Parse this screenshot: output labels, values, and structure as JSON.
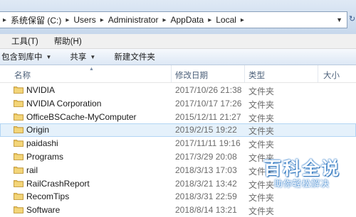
{
  "address_bar": {
    "crumbs": [
      "系统保留 (C:)",
      "Users",
      "Administrator",
      "AppData",
      "Local"
    ],
    "separator": "▸"
  },
  "menu": {
    "items": [
      "工具(T)",
      "帮助(H)"
    ]
  },
  "toolbar": {
    "include_library": "包含到库中",
    "share": "共享",
    "new_folder": "新建文件夹"
  },
  "columns": {
    "name": "名称",
    "date": "修改日期",
    "type": "类型",
    "size": "大小"
  },
  "files": [
    {
      "name": "NVIDIA",
      "date": "2017/10/26 21:38",
      "type": "文件夹"
    },
    {
      "name": "NVIDIA Corporation",
      "date": "2017/10/17 17:26",
      "type": "文件夹"
    },
    {
      "name": "OfficeBSCache-MyComputer",
      "date": "2015/12/11 21:27",
      "type": "文件夹"
    },
    {
      "name": "Origin",
      "date": "2019/2/15 19:22",
      "type": "文件夹",
      "selected": true
    },
    {
      "name": "paidashi",
      "date": "2017/11/11 19:16",
      "type": "文件夹"
    },
    {
      "name": "Programs",
      "date": "2017/3/29 20:08",
      "type": "文件夹"
    },
    {
      "name": "rail",
      "date": "2018/3/13 17:03",
      "type": "文件夹"
    },
    {
      "name": "RailCrashReport",
      "date": "2018/3/21 13:42",
      "type": "文件夹"
    },
    {
      "name": "RecomTips",
      "date": "2018/3/31 22:59",
      "type": "文件夹"
    },
    {
      "name": "Software",
      "date": "2018/8/14 13:21",
      "type": "文件夹"
    }
  ],
  "watermark": {
    "title": "百科全说",
    "subtitle": "助你轻松解决"
  },
  "colors": {
    "selection": "#e5f1fb",
    "folder": "#e8c25a",
    "header_text": "#4c607a"
  }
}
